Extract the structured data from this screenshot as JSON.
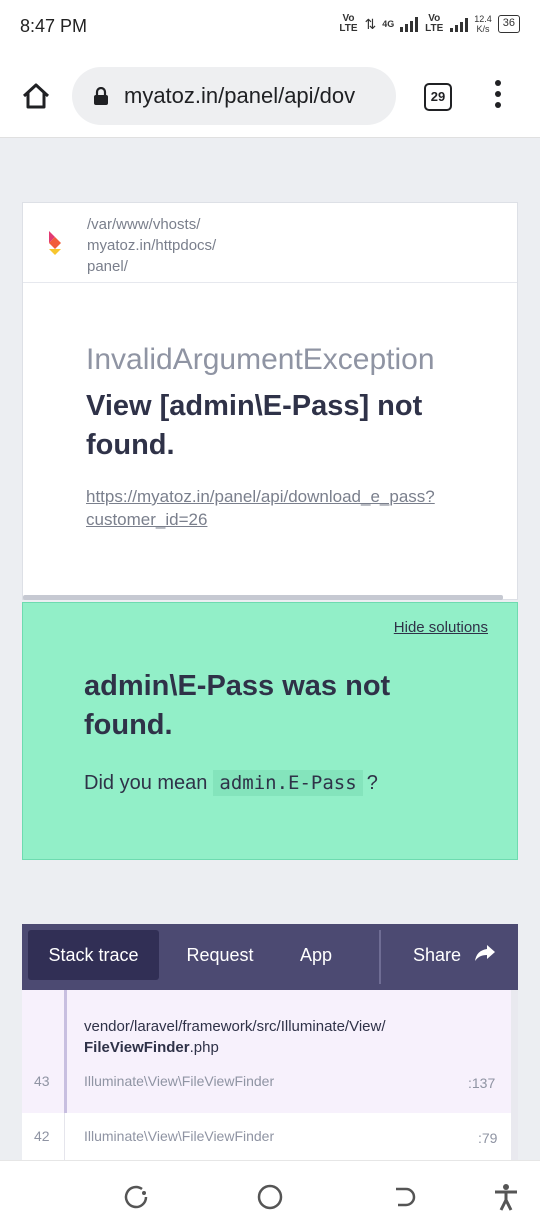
{
  "status_bar": {
    "time": "8:47 PM",
    "network": "Vo LTE",
    "network2": "4G",
    "network3": "Vo LTE",
    "speed": "12.4",
    "speed_unit": "K/s",
    "battery": "36"
  },
  "browser": {
    "url": "myatoz.in/panel/api/dov",
    "tab_count": "29"
  },
  "error": {
    "path_lines": [
      "/var/www/vhosts/",
      "myatoz.in/httpdocs/",
      "panel/"
    ],
    "exception_class": "InvalidArgumentException",
    "message": "View [admin\\E-Pass] not found.",
    "url_line1": "https://myatoz.in/panel/api/download_e_pass?",
    "url_line2": "customer_id=26"
  },
  "solution": {
    "hide_label": "Hide solutions",
    "title": "admin\\E-Pass was not found.",
    "text": "Did you mean",
    "suggestion": "admin.E-Pass",
    "suffix": "?"
  },
  "stack_nav": {
    "tabs": [
      "Stack trace",
      "Request",
      "App"
    ],
    "share": "Share"
  },
  "frames": {
    "active_file_path": "vendor/laravel/framework/src/Illuminate/View/",
    "active_file_name": "FileViewFinder",
    "active_file_ext": ".php",
    "rows": [
      {
        "index": "43",
        "class_prefix": "Illuminate\\View\\",
        "class_name": "FileViewFinder",
        "line": ":137"
      },
      {
        "index": "42",
        "class_prefix": "Illuminate\\View\\",
        "class_name": "FileViewFinder",
        "line": ":79"
      }
    ]
  }
}
